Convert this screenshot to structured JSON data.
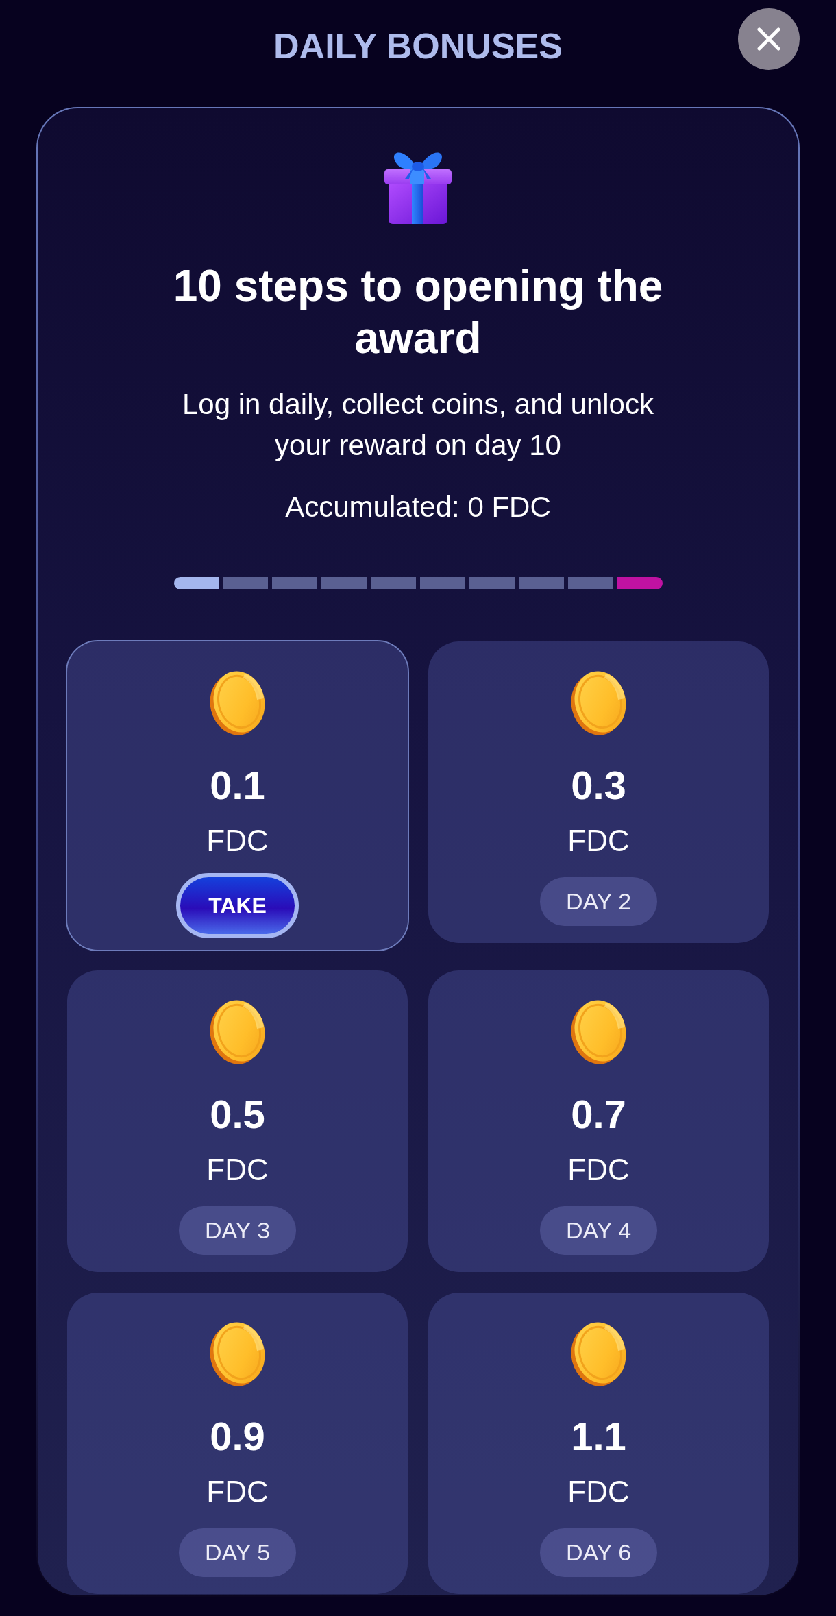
{
  "header": {
    "title": "DAILY BONUSES"
  },
  "panel": {
    "heading": "10 steps to opening the award",
    "description": "Log in daily, collect coins, and unlock your reward on day 10",
    "accumulated": "Accumulated: 0 FDC",
    "progress": {
      "segments": [
        {
          "kind": "reached"
        },
        {
          "kind": "pending"
        },
        {
          "kind": "pending"
        },
        {
          "kind": "pending"
        },
        {
          "kind": "pending"
        },
        {
          "kind": "pending"
        },
        {
          "kind": "pending"
        },
        {
          "kind": "pending"
        },
        {
          "kind": "pending"
        },
        {
          "kind": "award"
        }
      ]
    },
    "rewards": [
      {
        "amount": "0.1",
        "unit": "FDC",
        "kind": "available",
        "action": "TAKE"
      },
      {
        "amount": "0.3",
        "unit": "FDC",
        "kind": "locked",
        "action": "DAY 2"
      },
      {
        "amount": "0.5",
        "unit": "FDC",
        "kind": "locked",
        "action": "DAY 3"
      },
      {
        "amount": "0.7",
        "unit": "FDC",
        "kind": "locked",
        "action": "DAY 4"
      },
      {
        "amount": "0.9",
        "unit": "FDC",
        "kind": "locked",
        "action": "DAY 5"
      },
      {
        "amount": "1.1",
        "unit": "FDC",
        "kind": "locked",
        "action": "DAY 6"
      }
    ]
  }
}
